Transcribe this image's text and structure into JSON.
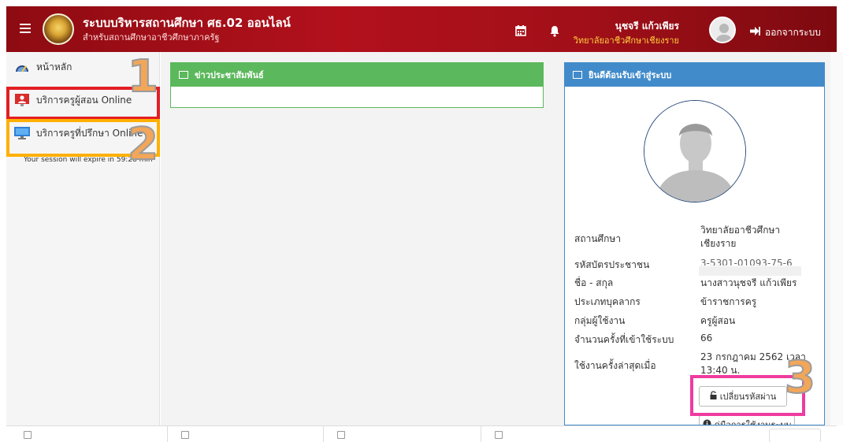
{
  "header": {
    "title": "ระบบบริหารสถานศึกษา ศธ.02 ออนไลน์",
    "subtitle": "สำหรับสถานศึกษาอาชีวศึกษาภาครัฐ",
    "user_name": "นุชจรี แก้วเพียร",
    "user_org": "วิทยาลัยอาชีวศึกษาเชียงราย",
    "logout_label": "ออกจากระบบ",
    "colors": {
      "bar": "#a10f18",
      "org_text": "#ffd23f"
    }
  },
  "sidebar": {
    "items": [
      {
        "label": "หน้าหลัก",
        "icon": "dashboard-icon"
      },
      {
        "label": "บริการครูผู้สอน Online",
        "icon": "teacher-icon"
      },
      {
        "label": "บริการครูที่ปรึกษา Online",
        "icon": "monitor-icon"
      }
    ],
    "session_text": "Your session will expire in 59:28 min"
  },
  "annotations": {
    "one": "1",
    "two": "2",
    "three": "3"
  },
  "news_panel": {
    "title": "ข่าวประชาสัมพันธ์"
  },
  "welcome_panel": {
    "title": "ยินดีต้อนรับเข้าสู่ระบบ",
    "rows": [
      {
        "label": "สถานศึกษา",
        "value": "วิทยาลัยอาชีวศึกษา เชียงราย"
      },
      {
        "label": "รหัสบัตรประชาชน",
        "value": "3-5301-01093-75-6"
      },
      {
        "label": "ชื่อ - สกุล",
        "value": "นางสาวนุชจรี แก้วเพียร"
      },
      {
        "label": "ประเภทบุคลากร",
        "value": "ข้าราชการครู"
      },
      {
        "label": "กลุ่มผู้ใช้งาน",
        "value": "ครูผู้สอน"
      },
      {
        "label": "จำนวนครั้งที่เข้าใช้ระบบ",
        "value": "66"
      },
      {
        "label": "ใช้งานครั้งล่าสุดเมื่อ",
        "value": "23 กรกฎาคม 2562 เวลา 13:40 น."
      }
    ],
    "change_password_label": "เปลี่ยนรหัสผ่าน",
    "manual_label": "คู่มือการใช้งานระบบ"
  }
}
